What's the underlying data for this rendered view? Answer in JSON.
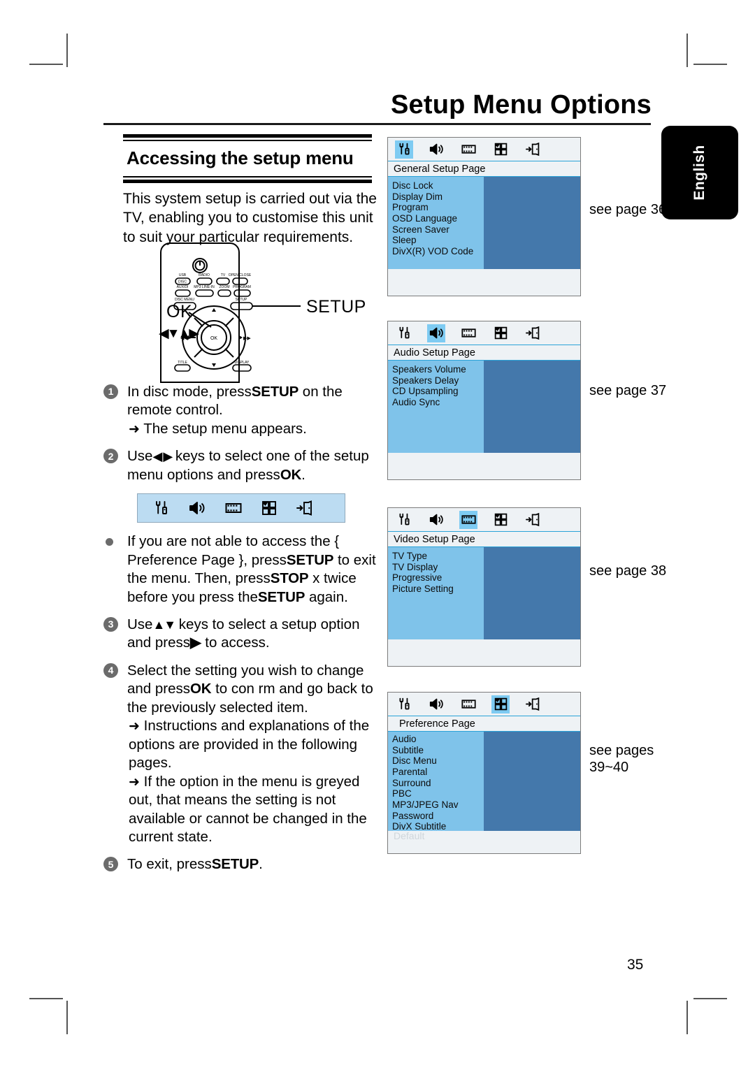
{
  "document": {
    "title": "Setup Menu Options",
    "page_number": "35",
    "side_tab": "English"
  },
  "section": {
    "heading": "Accessing the setup menu",
    "intro": "This system setup is carried out via the TV, enabling you to customise this unit to suit your particular requirements."
  },
  "remote": {
    "label_ok": "OK",
    "label_setup": "SETUP",
    "label_navkeys": "◀▼▲▶",
    "buttons": {
      "power": "power-icon",
      "row1": [
        "USB\nDISC",
        "RADIO",
        "TV",
        "OPEN/CLOSE"
      ],
      "row2": [
        "AUX/DI",
        "MP3 LINE-IN",
        "ZOOM",
        "PROGRAM"
      ],
      "row3": [
        "DISC MENU",
        "SETUP"
      ],
      "row4": [
        "TITLE",
        "DISPLAY"
      ],
      "center": "OK"
    }
  },
  "steps": [
    {
      "marker": "1",
      "type": "number",
      "text_before": "In disc mode, press",
      "key": "SETUP",
      "text_after": " on the remote control.",
      "sub": [
        "The setup menu appears."
      ]
    },
    {
      "marker": "2",
      "type": "number",
      "text_before": "Use",
      "keys_glyph": "◀ ▶",
      "text_mid": " keys to select one of the setup menu options and press",
      "key": "OK",
      "text_after": ".",
      "sub": []
    },
    {
      "marker": "•",
      "type": "bullet",
      "segments": [
        {
          "t": "If you are not able to access the { Preference Page }, press",
          "b": false
        },
        {
          "t": "SETUP",
          "b": true
        },
        {
          "t": " to exit the menu. Then, press",
          "b": false
        },
        {
          "t": "STOP",
          "b": true
        },
        {
          "t": " x twice before you press the",
          "b": false
        },
        {
          "t": "SETUP",
          "b": true
        },
        {
          "t": " again.",
          "b": false
        }
      ]
    },
    {
      "marker": "3",
      "type": "number",
      "text_before": "Use",
      "keys_glyph": "▲▼",
      "text_mid": " keys to select a setup option and press",
      "key": "▶",
      "text_after": " to access.",
      "sub": []
    },
    {
      "marker": "4",
      "type": "number",
      "text_before": "Select the setting you wish to change and press",
      "key": "OK",
      "text_after": " to con rm and go back to the previously selected item.",
      "sub": [
        "Instructions and explanations of the options are provided in the following pages.",
        "If the option in the menu is greyed out, that means the setting is not available or cannot be changed in the current state."
      ]
    },
    {
      "marker": "5",
      "type": "number",
      "text_before": "To exit, press",
      "key": "SETUP",
      "text_after": ".",
      "sub": []
    }
  ],
  "icon_strip": {
    "icons": [
      "general-setup-icon",
      "audio-setup-icon",
      "video-setup-icon",
      "preference-icon",
      "exit-icon"
    ]
  },
  "screens": [
    {
      "name": "general-setup-screen",
      "selected_index": 0,
      "page_title": "General Setup Page",
      "items": [
        "Disc Lock",
        "Display Dim",
        "Program",
        "OSD Language",
        "Screen Saver",
        "Sleep",
        "DivX(R) VOD Code"
      ],
      "footer": "",
      "see_page": "see page 36"
    },
    {
      "name": "audio-setup-screen",
      "selected_index": 1,
      "page_title": "Audio Setup Page",
      "items": [
        "Speakers Volume",
        "Speakers Delay",
        "CD Upsampling",
        "Audio Sync"
      ],
      "footer": "",
      "see_page": "see page 37"
    },
    {
      "name": "video-setup-screen",
      "selected_index": 2,
      "page_title": "Video Setup Page",
      "items": [
        "TV Type",
        "TV Display",
        "Progressive",
        "Picture Setting"
      ],
      "footer": "",
      "see_page": "see page 38"
    },
    {
      "name": "preference-screen",
      "selected_index": 3,
      "page_title": "Preference Page",
      "items": [
        "Audio",
        "Subtitle",
        "Disc Menu",
        "Parental",
        "Surround",
        "PBC",
        "MP3/JPEG Nav",
        "Password",
        "DivX Subtitle"
      ],
      "footer": "Default",
      "see_page": "see pages 39~40"
    }
  ],
  "colors": {
    "list_bg": "#7fc3ea",
    "panel_bg": "#4478ab",
    "chrome_bg": "#eef2f5",
    "highlight": "#7ecbf2",
    "strip_bg": "#bcdcf2",
    "accent_line": "#2aa3d8"
  }
}
